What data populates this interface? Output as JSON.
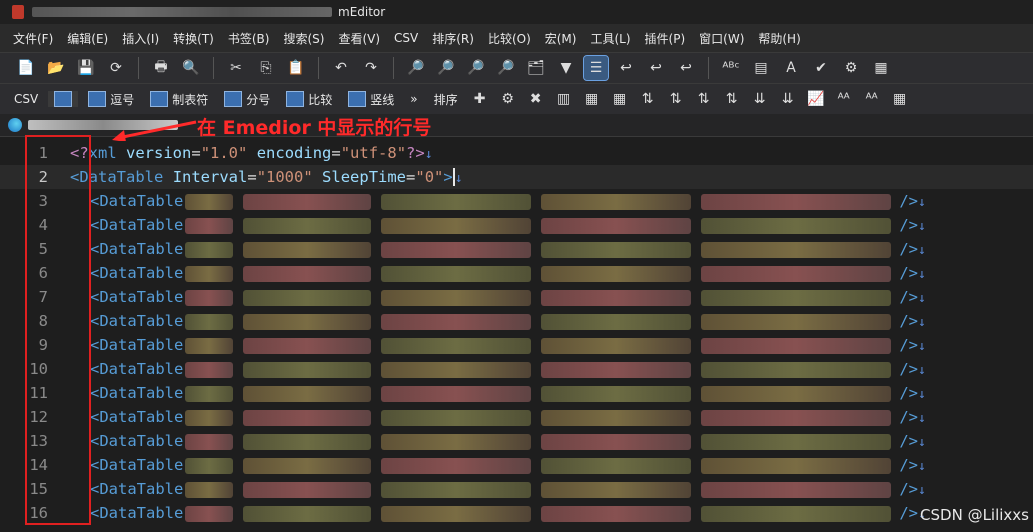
{
  "window": {
    "title_suffix": "mEditor"
  },
  "menu": [
    "文件(F)",
    "编辑(E)",
    "插入(I)",
    "转换(T)",
    "书签(B)",
    "搜索(S)",
    "查看(V)",
    "CSV",
    "排序(R)",
    "比较(O)",
    "宏(M)",
    "工具(L)",
    "插件(P)",
    "窗口(W)",
    "帮助(H)"
  ],
  "toolbar2": {
    "csv": "CSV",
    "items": [
      "逗号",
      "制表符",
      "分号",
      "比较",
      "竖线"
    ],
    "sort": "排序"
  },
  "annotation": "在 Emedior 中显示的行号",
  "editor": {
    "line1": {
      "num": "1",
      "open": "<?",
      "name": "xml",
      "a1": "version",
      "v1": "\"1.0\"",
      "a2": "encoding",
      "v2": "\"utf-8\"",
      "close": "?>"
    },
    "line2": {
      "num": "2",
      "tag": "DataTable",
      "a1": "Interval",
      "v1": "\"1000\"",
      "a2": "SleepTime",
      "v2": "\"0\""
    },
    "rows": [
      {
        "num": "3",
        "text": "<DataTable",
        "end": "/>"
      },
      {
        "num": "4",
        "text": "<DataTable",
        "end": "/>"
      },
      {
        "num": "5",
        "text": "<DataTable",
        "end": "/>"
      },
      {
        "num": "6",
        "text": "<DataTable",
        "end": "/>"
      },
      {
        "num": "7",
        "text": "<DataTable",
        "end": "/>"
      },
      {
        "num": "8",
        "text": "<DataTable",
        "end": "/>"
      },
      {
        "num": "9",
        "text": "<DataTable",
        "end": "/>"
      },
      {
        "num": "10",
        "text": "<DataTable",
        "end": "/>"
      },
      {
        "num": "11",
        "text": "<DataTable",
        "end": "/>"
      },
      {
        "num": "12",
        "text": "<DataTable",
        "end": "/>"
      },
      {
        "num": "13",
        "text": "<DataTable",
        "end": "/>"
      },
      {
        "num": "14",
        "text": "<DataTable",
        "end": "/>"
      },
      {
        "num": "15",
        "text": "<DataTable",
        "end": "/>"
      },
      {
        "num": "16",
        "text": "<DataTable",
        "end": "/>"
      }
    ]
  },
  "watermark": "CSDN @Lilixxs",
  "colors": {
    "annotation": "#ff2a2a",
    "tag": "#569cd6",
    "attr": "#9cdcfe",
    "value": "#ce9178"
  }
}
